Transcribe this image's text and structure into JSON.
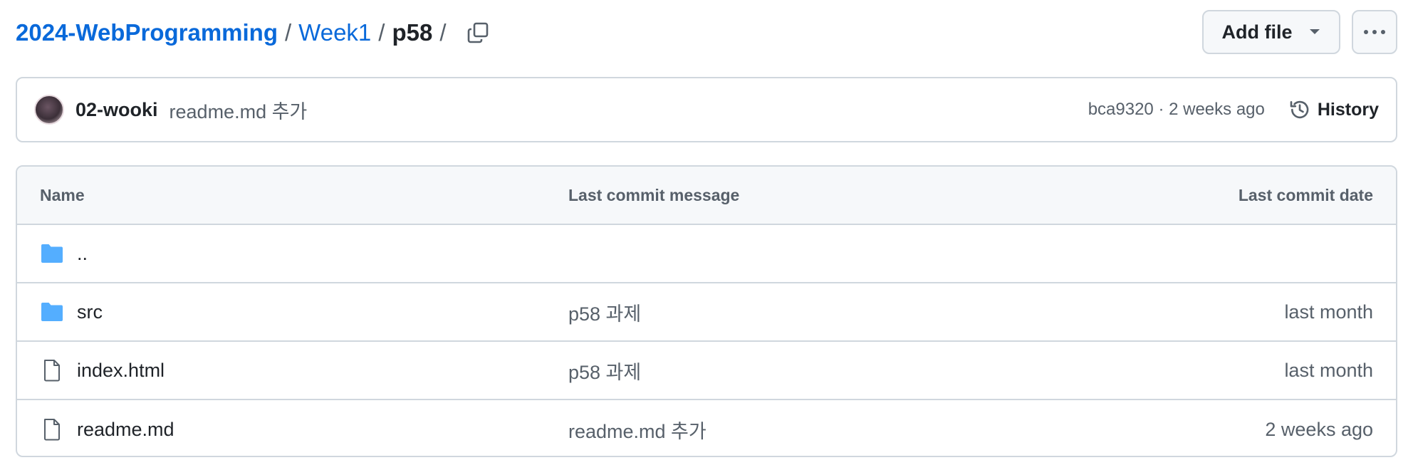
{
  "breadcrumb": {
    "repo": "2024-WebProgramming",
    "sep1": "/",
    "folder": "Week1",
    "sep2": "/",
    "current": "p58",
    "sep3": "/"
  },
  "actions": {
    "add_file_label": "Add file"
  },
  "commit": {
    "author": "02-wooki",
    "message": "readme.md 추가",
    "meta": "bca9320 · 2 weeks ago",
    "history_label": "History"
  },
  "table": {
    "headers": {
      "name": "Name",
      "message": "Last commit message",
      "date": "Last commit date"
    },
    "rows": [
      {
        "type": "parent",
        "name": "..",
        "message": "",
        "date": ""
      },
      {
        "type": "folder",
        "name": "src",
        "message": "p58 과제",
        "date": "last month"
      },
      {
        "type": "file",
        "name": "index.html",
        "message": "p58 과제",
        "date": "last month"
      },
      {
        "type": "file",
        "name": "readme.md",
        "message": "readme.md 추가",
        "date": "2 weeks ago"
      }
    ]
  },
  "colors": {
    "link": "#0969da",
    "folder_icon": "#54aeff",
    "border": "#d0d7de",
    "muted_text": "#57606a"
  }
}
